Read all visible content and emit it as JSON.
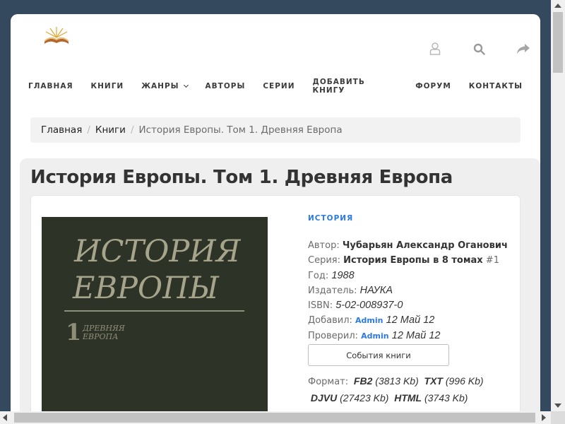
{
  "nav": {
    "items": [
      {
        "label": "ГЛАВНАЯ",
        "dropdown": false
      },
      {
        "label": "КНИГИ",
        "dropdown": false
      },
      {
        "label": "ЖАНРЫ",
        "dropdown": true
      },
      {
        "label": "АВТОРЫ",
        "dropdown": false
      },
      {
        "label": "СЕРИИ",
        "dropdown": false
      },
      {
        "label": "ДОБАВИТЬ КНИГУ",
        "dropdown": false
      },
      {
        "label": "ФОРУМ",
        "dropdown": false
      },
      {
        "label": "КОНТАКТЫ",
        "dropdown": false
      }
    ]
  },
  "header": {
    "icons": [
      "user-icon",
      "search-icon",
      "share-icon"
    ]
  },
  "breadcrumb": {
    "home": "Главная",
    "books": "Книги",
    "current": "История Европы. Том 1. Древняя Европа"
  },
  "book": {
    "title": "История Европы. Том 1. Древняя Европа",
    "genre": "ИСТОРИЯ",
    "cover": {
      "line1": "ИСТОРИЯ",
      "line2": "ЕВРОПЫ",
      "number": "1",
      "subtitle_line1": "ДРЕВНЯЯ",
      "subtitle_line2": "ЕВРОПА"
    },
    "author_label": "Автор:",
    "author": "Чубарьян Александр Оганович",
    "series_label": "Серия:",
    "series": "История Европы в 8 томах",
    "series_num": "#1",
    "year_label": "Год:",
    "year": "1988",
    "publisher_label": "Издатель:",
    "publisher": "НАУКА",
    "isbn_label": "ISBN:",
    "isbn": "5-02-008937-0",
    "added_label": "Добавил:",
    "added_by": "Admin",
    "added_date": "12 Май 12",
    "checked_label": "Проверил:",
    "checked_by": "Admin",
    "checked_date": "12 Май 12",
    "events_button": "События книги",
    "formats_label": "Формат:",
    "formats": [
      {
        "name": "FB2",
        "size": "(3813 Kb)"
      },
      {
        "name": "TXT",
        "size": "(996 Kb)"
      },
      {
        "name": "DJVU",
        "size": "(27423 Kb)"
      },
      {
        "name": "HTML",
        "size": "(3743 Kb)"
      }
    ]
  },
  "colors": {
    "background": "#34495e",
    "accent": "#2a7ae2",
    "text": "#333333"
  }
}
